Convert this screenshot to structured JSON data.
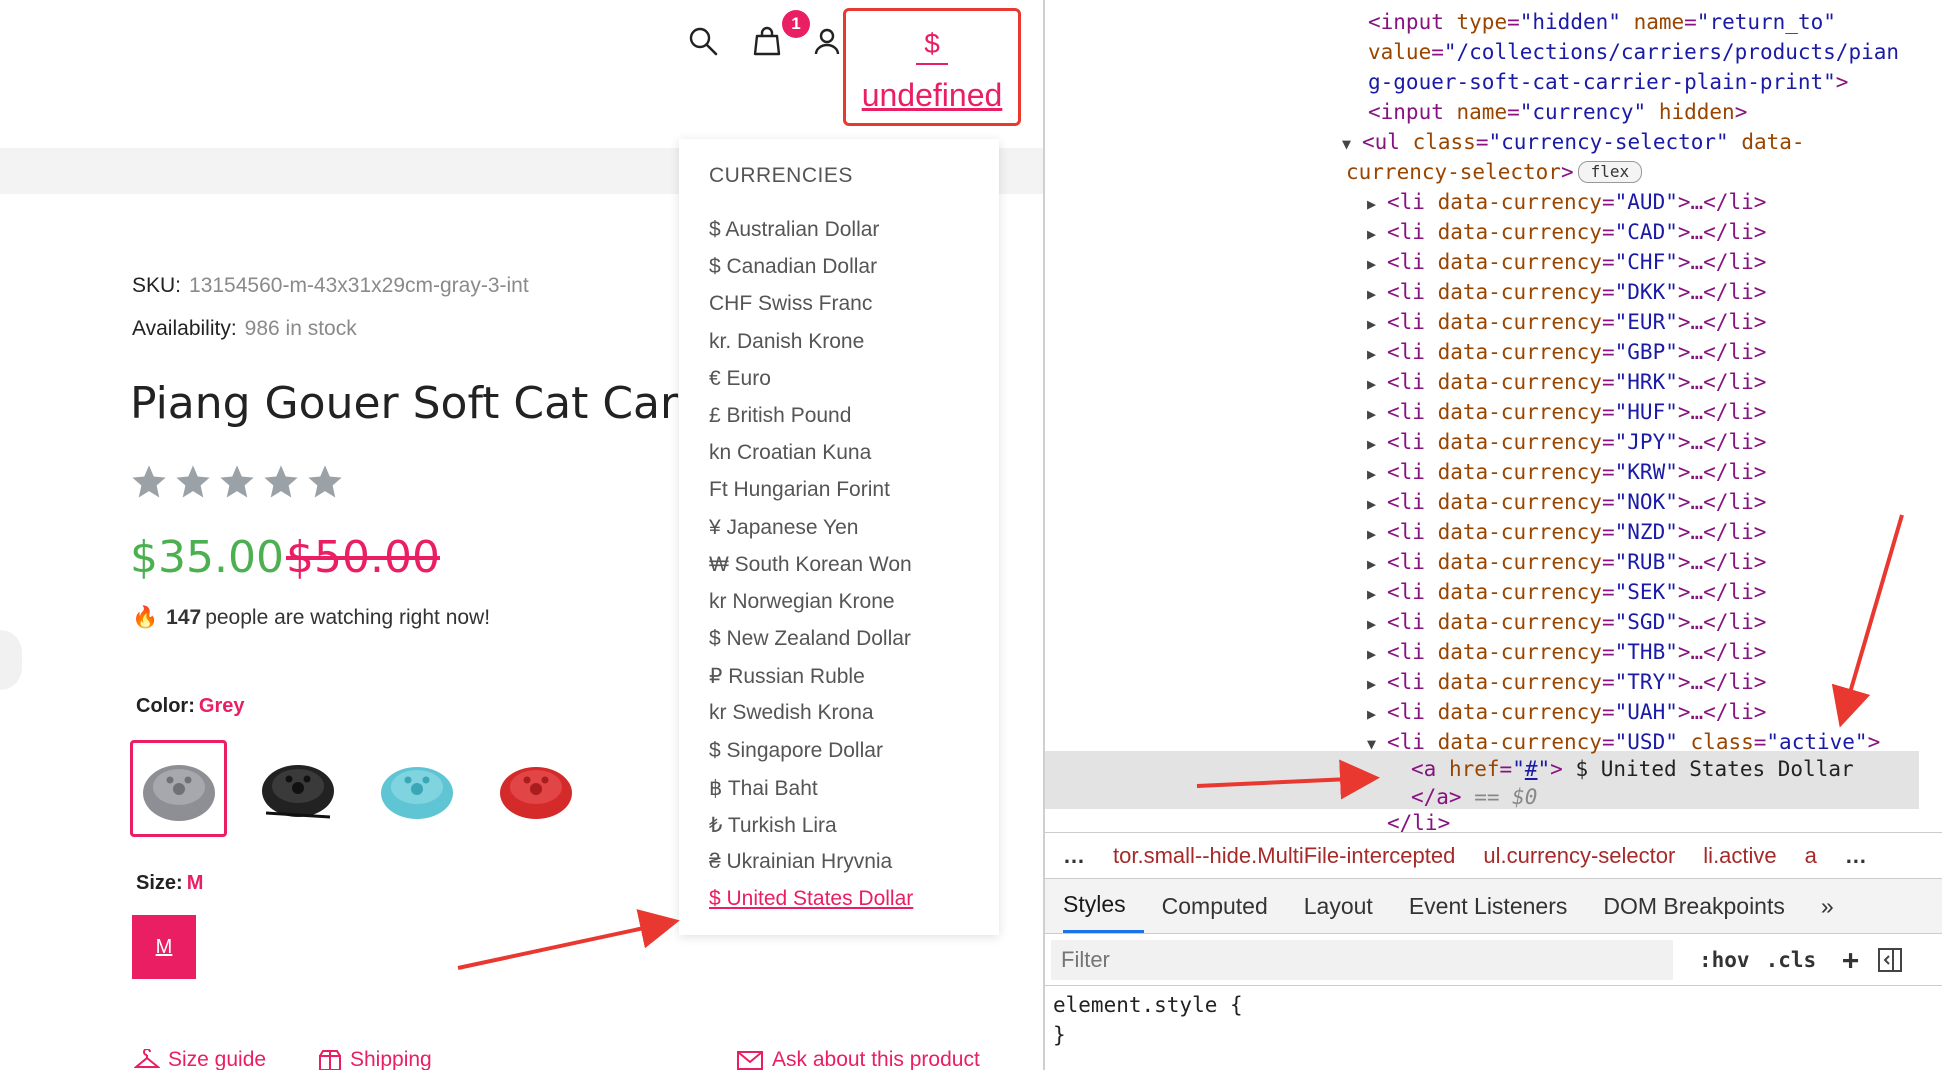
{
  "header": {
    "cart_count": "1",
    "currency_symbol": "$",
    "currency_label": "undefined",
    "icons": [
      "search-icon",
      "bag-icon",
      "user-icon"
    ]
  },
  "currency_menu": {
    "heading": "CURRENCIES",
    "items": [
      "$ Australian Dollar",
      "$ Canadian Dollar",
      "CHF Swiss Franc",
      "kr. Danish Krone",
      "€ Euro",
      "£ British Pound",
      "kn Croatian Kuna",
      "Ft Hungarian Forint",
      "¥ Japanese Yen",
      "₩ South Korean Won",
      "kr Norwegian Krone",
      "$ New Zealand Dollar",
      "₽ Russian Ruble",
      "kr Swedish Krona",
      "$ Singapore Dollar",
      "฿ Thai Baht",
      "₺ Turkish Lira",
      "₴ Ukrainian Hryvnia",
      "$ United States Dollar"
    ],
    "active_index": 18
  },
  "product": {
    "sku_label": "SKU:",
    "sku_value": "13154560-m-43x31x29cm-gray-3-int",
    "availability_label": "Availability:",
    "availability_value": "986 in stock",
    "title": "Piang Gouer Soft Cat Carrier",
    "rating": 0,
    "price": "$35.00",
    "compare_price": "$50.00",
    "watching_count": "147",
    "watching_text": "people are watching right now!",
    "color_label": "Color:",
    "color_value": "Grey",
    "swatches": [
      {
        "color": "#8d8f94",
        "selected": true
      },
      {
        "color": "#222222",
        "selected": false
      },
      {
        "color": "#5fc4d3",
        "selected": false
      },
      {
        "color": "#d42a2a",
        "selected": false
      }
    ],
    "size_label": "Size:",
    "size_value": "M",
    "size_button": "M",
    "links": {
      "size_guide": "Size guide",
      "shipping": "Shipping",
      "ask": "Ask about this product"
    }
  },
  "devtools": {
    "lines": {
      "l1_tag": "<input",
      "l1_a1": "type",
      "l1_v1": "\"hidden\"",
      "l1_a2": "name",
      "l1_v2": "\"return_to\"",
      "l2_a": "value",
      "l2_v": "\"/collections/carriers/products/pian",
      "l3_v": "g-gouer-soft-cat-carrier-plain-print\"",
      "l3_end": ">",
      "l4_tag": "<input",
      "l4_a1": "name",
      "l4_v1": "\"currency\"",
      "l4_a2": "hidden",
      "l4_end": ">",
      "l5_tag": "<ul",
      "l5_a1": "class",
      "l5_v1": "\"currency-selector\"",
      "l5_a2": "data-",
      "l6_a": "currency-selector",
      "l6_end": ">",
      "flex": "flex"
    },
    "li_codes": [
      "AUD",
      "CAD",
      "CHF",
      "DKK",
      "EUR",
      "GBP",
      "HRK",
      "HUF",
      "JPY",
      "KRW",
      "NOK",
      "NZD",
      "RUB",
      "SEK",
      "SGD",
      "THB",
      "TRY",
      "UAH"
    ],
    "li_prefix": "<li",
    "li_attr": "data-currency",
    "li_suffix": ">…</li>",
    "usd_code": "USD",
    "usd_class_attr": "class",
    "usd_class_val": "\"active\"",
    "anchor_open": "<a",
    "anchor_href_attr": "href",
    "anchor_href_val": "#",
    "anchor_text": " $ United States Dollar",
    "anchor_close": "</a>",
    "dollar_zero": "== $0",
    "li_close": "</li>",
    "breadcrumbs": [
      "…",
      "tor.small--hide.MultiFile-intercepted",
      "ul.currency-selector",
      "li.active",
      "a",
      "…"
    ],
    "tabs": [
      "Styles",
      "Computed",
      "Layout",
      "Event Listeners",
      "DOM Breakpoints",
      "»"
    ],
    "active_tab": "Styles",
    "filter_placeholder": "Filter",
    "hov": ":hov",
    "cls": ".cls",
    "plus": "+",
    "style_line1": "element.style {",
    "style_line2": "}"
  },
  "colors": {
    "accent": "#e91e63",
    "price_green": "#4caf50",
    "arrow_red": "#e8382f"
  }
}
